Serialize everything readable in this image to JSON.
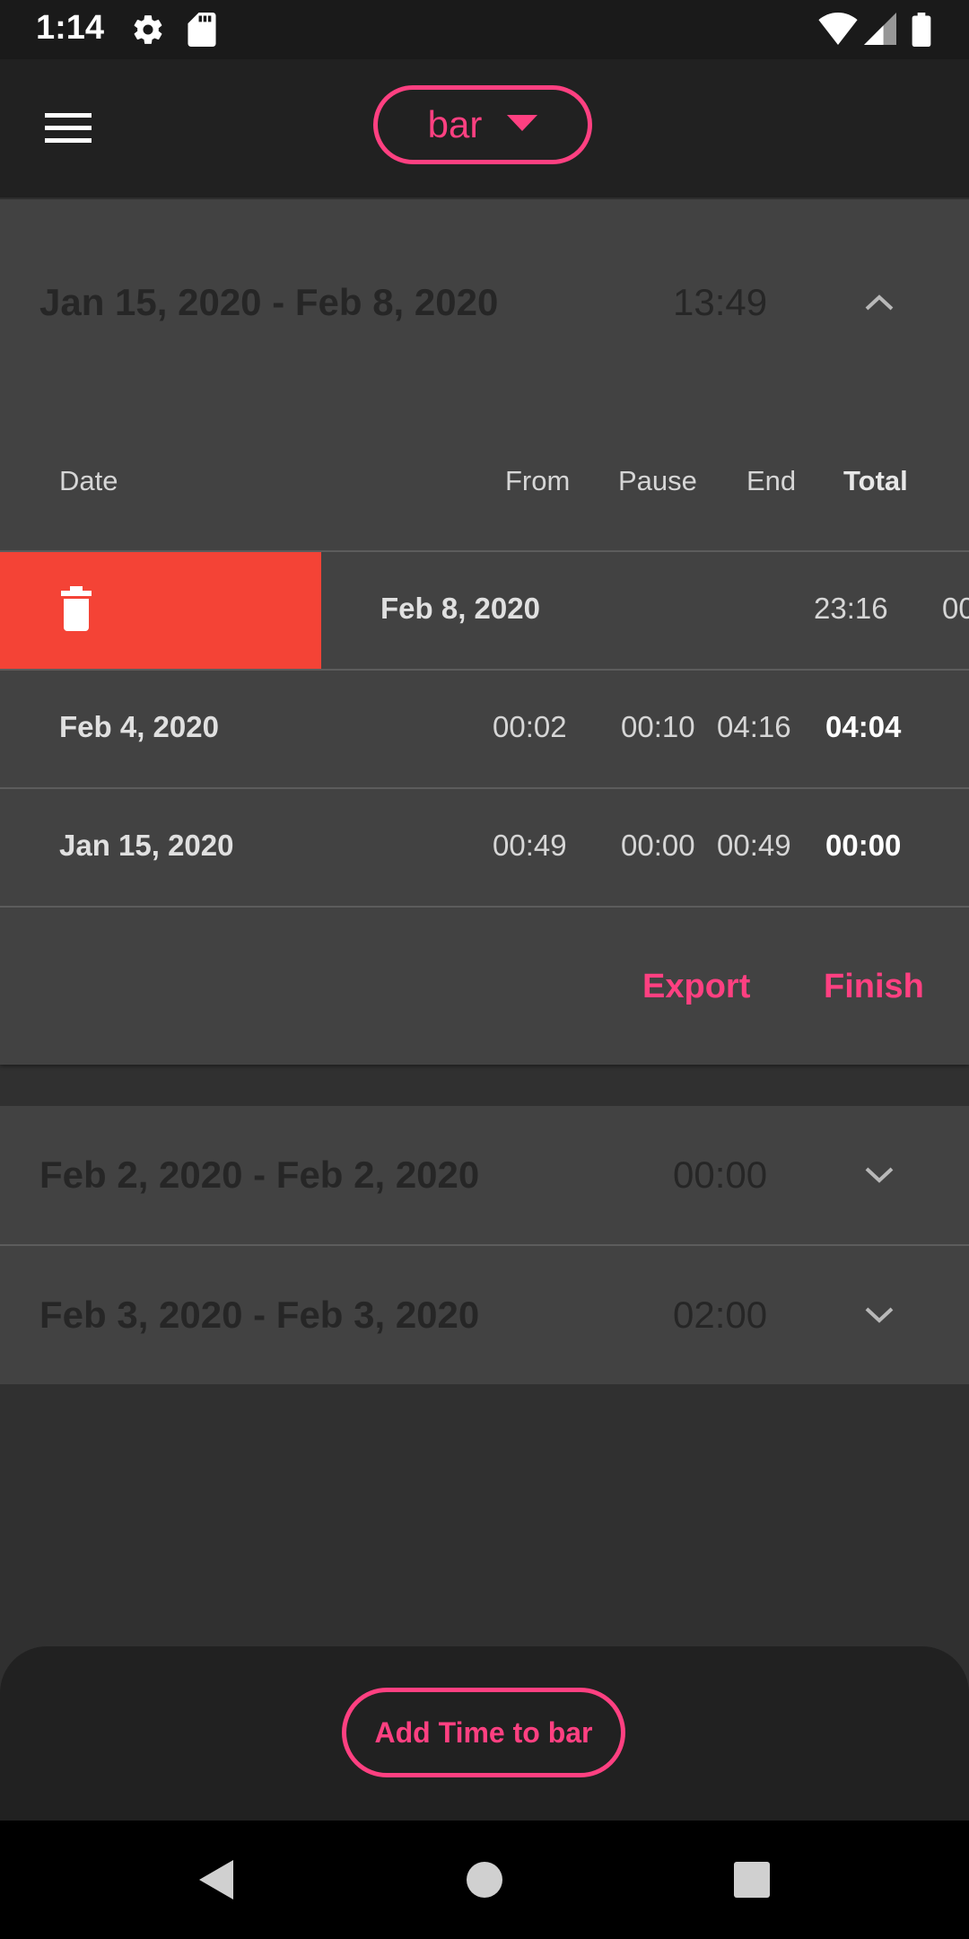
{
  "status_bar": {
    "time": "1:14",
    "icons": [
      "settings-icon",
      "sd-card-icon",
      "wifi-icon",
      "signal-icon",
      "battery-icon"
    ]
  },
  "app_bar": {
    "menu_icon": "menu-icon",
    "project_selector": {
      "value": "bar",
      "icon": "dropdown-arrow-icon"
    }
  },
  "colors": {
    "accent": "#ff4081",
    "delete": "#f44336",
    "card": "#424242",
    "background": "#303030",
    "bar": "#212121"
  },
  "periods": [
    {
      "range": "Jan 15, 2020 - Feb 8, 2020",
      "total": "13:49",
      "expanded": true,
      "columns": {
        "date": "Date",
        "from": "From",
        "pause": "Pause",
        "end": "End",
        "total": "Total"
      },
      "entries": [
        {
          "date": "Feb 8, 2020",
          "from": "23:16",
          "pause": "",
          "end": "",
          "total": "00",
          "swiped": true,
          "action_icon": "trash-icon"
        },
        {
          "date": "Feb 4, 2020",
          "from": "00:02",
          "pause": "00:10",
          "end": "04:16",
          "total": "04:04"
        },
        {
          "date": "Jan 15, 2020",
          "from": "00:49",
          "pause": "00:00",
          "end": "00:49",
          "total": "00:00"
        }
      ],
      "actions": {
        "export": "Export",
        "finish": "Finish"
      }
    },
    {
      "range": "Feb 2, 2020 - Feb 2, 2020",
      "total": "00:00",
      "expanded": false
    },
    {
      "range": "Feb 3, 2020 - Feb 3, 2020",
      "total": "02:00",
      "expanded": false
    }
  ],
  "bottom": {
    "add_time_label": "Add Time to bar"
  },
  "nav_bar": {
    "back": "back-icon",
    "home": "home-icon",
    "recents": "recents-icon"
  }
}
